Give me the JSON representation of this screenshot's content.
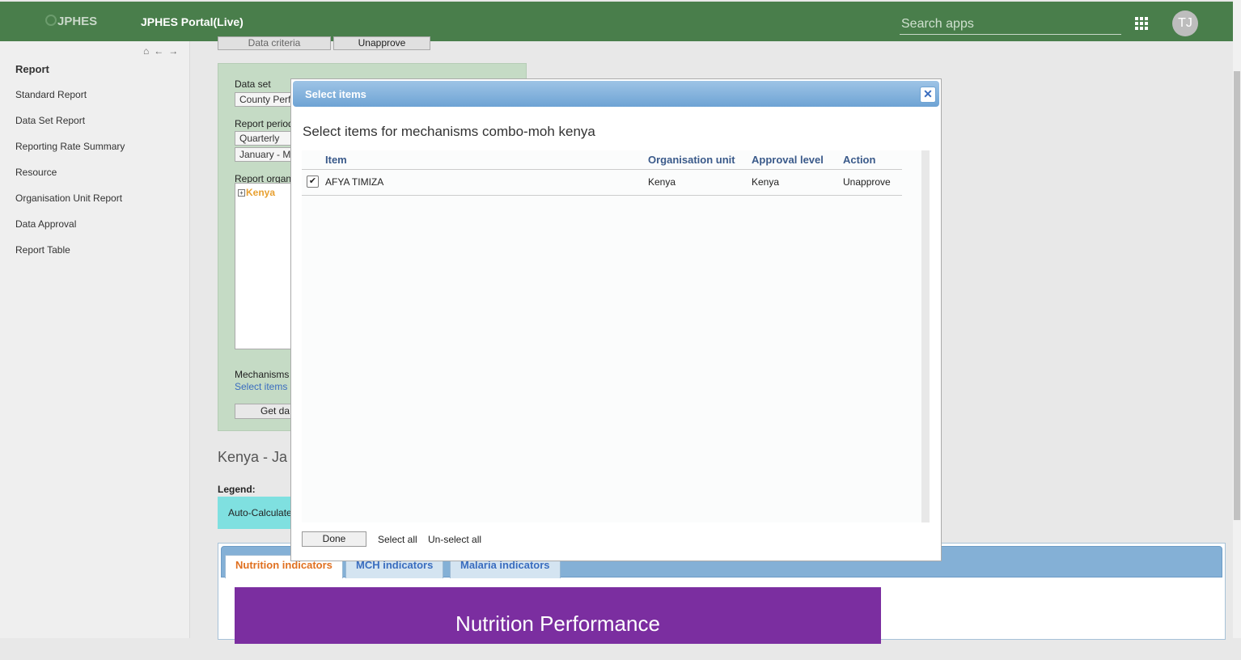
{
  "header": {
    "logo_text": "JPHES",
    "app_title": "JPHES Portal(Live)",
    "search_placeholder": "Search apps",
    "avatar_initials": "TJ"
  },
  "sidebar": {
    "nav_icons": [
      "home-icon",
      "back-arrow-icon",
      "forward-arrow-icon"
    ],
    "heading": "Report",
    "items": [
      {
        "label": "Standard Report"
      },
      {
        "label": "Data Set Report"
      },
      {
        "label": "Reporting Rate Summary"
      },
      {
        "label": "Resource"
      },
      {
        "label": "Organisation Unit Report"
      },
      {
        "label": "Data Approval"
      },
      {
        "label": "Report Table"
      }
    ]
  },
  "toolbar": {
    "data_criteria_label": "Data criteria",
    "unapprove_label": "Unapprove"
  },
  "criteria": {
    "data_set_label": "Data set",
    "data_set_value": "County Perf",
    "report_period_label": "Report period",
    "period_type_value": "Quarterly",
    "period_value": "January - M",
    "report_org_label": "Report organ",
    "tree_root": "Kenya",
    "mechanisms_label": "Mechanisms",
    "select_items_link": "Select items",
    "get_data_label": "Get da"
  },
  "report": {
    "heading": "Kenya - Ja",
    "legend_label": "Legend:",
    "legend_item": "Auto-Calculate",
    "tabs": [
      {
        "label": "Nutrition indicators",
        "active": true
      },
      {
        "label": "MCH indicators",
        "active": false
      },
      {
        "label": "Malaria indicators",
        "active": false
      }
    ],
    "banner_title": "Nutrition Performance"
  },
  "dialog": {
    "title": "Select items",
    "heading": "Select items for mechanisms combo-moh kenya",
    "columns": [
      "Item",
      "Organisation unit",
      "Approval level",
      "Action"
    ],
    "rows": [
      {
        "checked": true,
        "item": "AFYA TIMIZA",
        "org_unit": "Kenya",
        "approval_level": "Kenya",
        "action": "Unapprove"
      }
    ],
    "done_label": "Done",
    "select_all_label": "Select all",
    "unselect_all_label": "Un-select all"
  },
  "colors": {
    "header_green": "#497e4b",
    "criteria_bg": "#c5dbc5",
    "dialog_title_blue": "#6ea3d4",
    "banner_purple": "#7b2ea0",
    "active_tab_orange": "#e07020"
  }
}
